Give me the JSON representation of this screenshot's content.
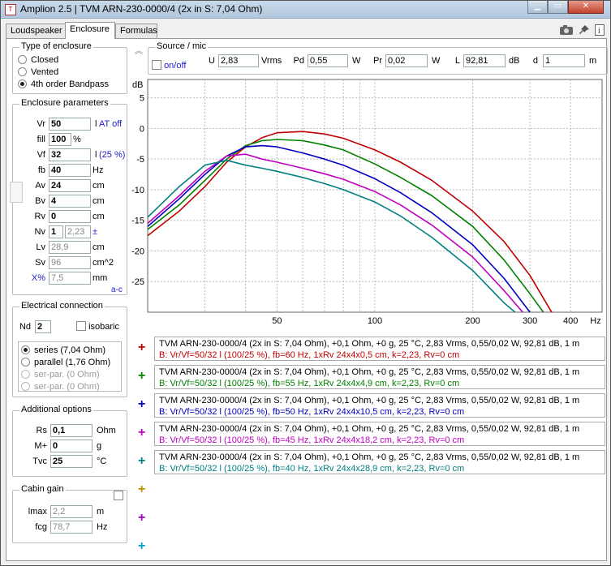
{
  "window": {
    "title": "Amplion 2.5 | TVM ARN-230-0000/4 (2x in S: 7,04 Ohm)",
    "icon_text": "T"
  },
  "tabs": [
    "Loudspeaker",
    "Enclosure",
    "Formulas"
  ],
  "enclosure_type": {
    "title": "Type of enclosure",
    "options": [
      "Closed",
      "Vented",
      "4th order Bandpass"
    ],
    "selected": 2
  },
  "enclosure_params": {
    "title": "Enclosure parameters",
    "vr": {
      "label": "Vr",
      "value": "50",
      "unit": "l",
      "extra": "AT off"
    },
    "fill": {
      "label": "fill",
      "value": "100",
      "unit": "%"
    },
    "vf": {
      "label": "Vf",
      "value": "32",
      "unit": "l",
      "extra": "(25 %)"
    },
    "fb": {
      "label": "fb",
      "value": "40",
      "unit": "Hz"
    },
    "av": {
      "label": "Av",
      "value": "24",
      "unit": "cm"
    },
    "bv": {
      "label": "Bv",
      "value": "4",
      "unit": "cm"
    },
    "rv": {
      "label": "Rv",
      "value": "0",
      "unit": "cm"
    },
    "nv": {
      "label": "Nv",
      "value": "1",
      "value2": "2,23",
      "unit": "±"
    },
    "lv": {
      "label": "Lv",
      "value": "28,9",
      "unit": "cm"
    },
    "sv": {
      "label": "Sv",
      "value": "96",
      "unit": "cm^2"
    },
    "xpct": {
      "label": "X%",
      "value": "7,5",
      "unit": "mm"
    },
    "ac_link": "a-c"
  },
  "electrical": {
    "title": "Electrical connection",
    "nd_label": "Nd",
    "nd_value": "2",
    "isobaric": "isobaric",
    "options": [
      "series (7,04 Ohm)",
      "parallel (1,76 Ohm)",
      "ser-par. (0 Ohm)",
      "ser-par. (0 Ohm)"
    ],
    "selected": 0
  },
  "additional": {
    "title": "Additional options",
    "rs": {
      "label": "Rs",
      "value": "0,1",
      "unit": "Ohm"
    },
    "mplus": {
      "label": "M+",
      "value": "0",
      "unit": "g"
    },
    "tvc": {
      "label": "Tvc",
      "value": "25",
      "unit": "°C"
    }
  },
  "cabin": {
    "title": "Cabin gain",
    "lmax": {
      "label": "lmax",
      "value": "2,2",
      "unit": "m"
    },
    "fcg": {
      "label": "fcg",
      "value": "78,7",
      "unit": "Hz"
    }
  },
  "source": {
    "title": "Source / mic",
    "onoff": "on/off",
    "u": {
      "label": "U",
      "value": "2,83",
      "unit": "Vrms"
    },
    "pd": {
      "label": "Pd",
      "value": "0,55",
      "unit": "W"
    },
    "pr": {
      "label": "Pr",
      "value": "0,02",
      "unit": "W"
    },
    "l": {
      "label": "L",
      "value": "92,81",
      "unit": "dB"
    },
    "d": {
      "label": "d",
      "value": "1",
      "unit": "m"
    }
  },
  "chart_data": {
    "type": "line",
    "ylabel": "dB",
    "xlabel": "Hz",
    "xscale": "log",
    "xlim": [
      20,
      500
    ],
    "ylim": [
      -30,
      8
    ],
    "x_ticks": [
      "50",
      "100",
      "200",
      "300",
      "400"
    ],
    "x_tick_values": [
      50,
      100,
      200,
      300,
      400
    ],
    "y_ticks": [
      "5",
      "0",
      "-5",
      "-10",
      "-15",
      "-20",
      "-25"
    ],
    "y_tick_values": [
      5,
      0,
      -5,
      -10,
      -15,
      -20,
      -25
    ],
    "grid": true,
    "series": [
      {
        "color": "#c00000",
        "x": [
          20,
          25,
          30,
          35,
          40,
          45,
          50,
          60,
          70,
          80,
          100,
          120,
          150,
          200,
          250,
          300,
          350
        ],
        "y": [
          -17.5,
          -13.5,
          -9.5,
          -5.5,
          -3.0,
          -1.5,
          -0.7,
          -0.5,
          -0.9,
          -1.6,
          -3.5,
          -5.5,
          -8.5,
          -13.5,
          -18.5,
          -24.0,
          -30.0
        ]
      },
      {
        "color": "#008000",
        "x": [
          20,
          25,
          30,
          35,
          40,
          45,
          50,
          60,
          70,
          80,
          100,
          120,
          150,
          200,
          250,
          300,
          330
        ],
        "y": [
          -16.5,
          -12.5,
          -8.5,
          -5.0,
          -2.8,
          -2.0,
          -1.8,
          -2.0,
          -2.7,
          -3.5,
          -5.8,
          -8.0,
          -11.0,
          -16.0,
          -21.5,
          -27.0,
          -30.0
        ]
      },
      {
        "color": "#0000c0",
        "x": [
          20,
          25,
          30,
          35,
          40,
          45,
          50,
          60,
          70,
          80,
          100,
          120,
          150,
          200,
          250,
          300
        ],
        "y": [
          -16.0,
          -11.5,
          -7.5,
          -4.5,
          -3.0,
          -2.8,
          -3.0,
          -4.0,
          -5.0,
          -6.0,
          -8.2,
          -10.5,
          -13.8,
          -19.0,
          -24.5,
          -30.0
        ]
      },
      {
        "color": "#c000c0",
        "x": [
          20,
          25,
          30,
          35,
          40,
          45,
          50,
          60,
          70,
          80,
          100,
          120,
          150,
          200,
          250,
          285
        ],
        "y": [
          -15.5,
          -11.0,
          -7.0,
          -4.5,
          -4.2,
          -5.0,
          -5.5,
          -6.5,
          -7.4,
          -8.3,
          -10.3,
          -12.5,
          -15.8,
          -21.0,
          -26.5,
          -30.0
        ]
      },
      {
        "color": "#008080",
        "x": [
          20,
          25,
          30,
          35,
          40,
          45,
          50,
          60,
          70,
          80,
          100,
          120,
          150,
          200,
          250,
          270
        ],
        "y": [
          -14.5,
          -9.5,
          -6.0,
          -5.2,
          -6.0,
          -6.5,
          -7.0,
          -8.0,
          -9.0,
          -10.0,
          -12.0,
          -14.3,
          -17.8,
          -23.2,
          -28.5,
          -30.0
        ]
      }
    ]
  },
  "legend": [
    {
      "color": "#c00000",
      "line1": "TVM ARN-230-0000/4 (2x in S: 7,04 Ohm), +0,1 Ohm, +0 g, 25 °C, 2,83 Vrms, 0,55/0,02 W, 92,81 dB, 1 m",
      "line2": "B: Vr/Vf=50/32 l (100/25 %), fb=60 Hz, 1xRv 24x4x0,5 cm, k=2,23, Rv=0 cm"
    },
    {
      "color": "#008000",
      "line1": "TVM ARN-230-0000/4 (2x in S: 7,04 Ohm), +0,1 Ohm, +0 g, 25 °C, 2,83 Vrms, 0,55/0,02 W, 92,81 dB, 1 m",
      "line2": "B: Vr/Vf=50/32 l (100/25 %), fb=55 Hz, 1xRv 24x4x4,9 cm, k=2,23, Rv=0 cm"
    },
    {
      "color": "#0000c0",
      "line1": "TVM ARN-230-0000/4 (2x in S: 7,04 Ohm), +0,1 Ohm, +0 g, 25 °C, 2,83 Vrms, 0,55/0,02 W, 92,81 dB, 1 m",
      "line2": "B: Vr/Vf=50/32 l (100/25 %), fb=50 Hz, 1xRv 24x4x10,5 cm, k=2,23, Rv=0 cm"
    },
    {
      "color": "#c000c0",
      "line1": "TVM ARN-230-0000/4 (2x in S: 7,04 Ohm), +0,1 Ohm, +0 g, 25 °C, 2,83 Vrms, 0,55/0,02 W, 92,81 dB, 1 m",
      "line2": "B: Vr/Vf=50/32 l (100/25 %), fb=45 Hz, 1xRv 24x4x18,2 cm, k=2,23, Rv=0 cm"
    },
    {
      "color": "#008080",
      "line1": "TVM ARN-230-0000/4 (2x in S: 7,04 Ohm), +0,1 Ohm, +0 g, 25 °C, 2,83 Vrms, 0,55/0,02 W, 92,81 dB, 1 m",
      "line2": "B: Vr/Vf=50/32 l (100/25 %), fb=40 Hz, 1xRv 24x4x28,9 cm, k=2,23, Rv=0 cm"
    }
  ],
  "empty_slots": [
    {
      "color": "#c09000"
    },
    {
      "color": "#a000c0"
    },
    {
      "color": "#00a0c0"
    }
  ],
  "icons": [
    "camera-icon",
    "pin-icon",
    "info-icon",
    "collapse-icon"
  ],
  "plus_symbol": "+"
}
